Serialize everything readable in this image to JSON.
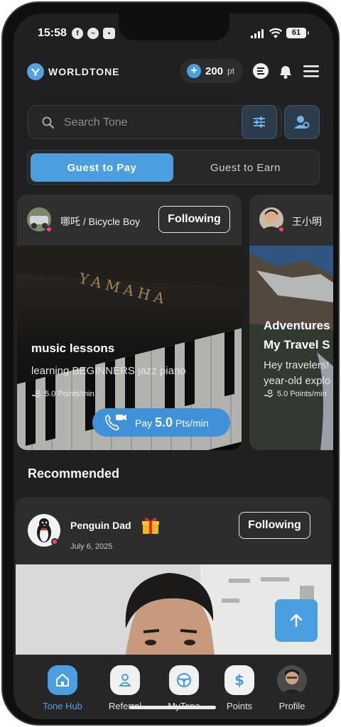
{
  "status_bar": {
    "time": "15:58",
    "battery": "61"
  },
  "header": {
    "brand": "WORLDTONE",
    "points_value": "200",
    "points_unit": "pt"
  },
  "search": {
    "placeholder": "Search Tone"
  },
  "mode_toggle": {
    "active": "Guest to Pay",
    "inactive": "Guest to Earn"
  },
  "cards": [
    {
      "name": "哪吒 / Bicycle Boy",
      "follow_label": "Following",
      "title": "music lessons",
      "description": "learning BEGINNERS jazz piano",
      "rate": "5.0 Points/min",
      "pay_prefix": "Pay",
      "pay_value": "5.0",
      "pay_unit": "Pts/min",
      "image_brand": "YAMAHA"
    },
    {
      "name": "王小明",
      "title": "Adventures",
      "title2": "My Travel S",
      "description": "Hey travelers!",
      "description2": "year-old explo",
      "rate": "5.0 Points/min"
    }
  ],
  "recommended": {
    "section_title": "Recommended",
    "name": "Penguin Dad",
    "date": "July 6, 2025",
    "follow_label": "Following"
  },
  "bottom_nav": [
    {
      "label": "Tone Hub",
      "icon": "home-icon",
      "active": true
    },
    {
      "label": "Referral",
      "icon": "referral-icon",
      "active": false
    },
    {
      "label": "MyTone",
      "icon": "steering-icon",
      "active": false
    },
    {
      "label": "Points",
      "icon": "dollar-icon",
      "active": false
    },
    {
      "label": "Profile",
      "icon": "profile-avatar",
      "active": false
    }
  ],
  "colors": {
    "accent": "#4b9fe0",
    "background": "#202020",
    "card": "#2f2f2f",
    "status_dot": "#f2485d"
  }
}
